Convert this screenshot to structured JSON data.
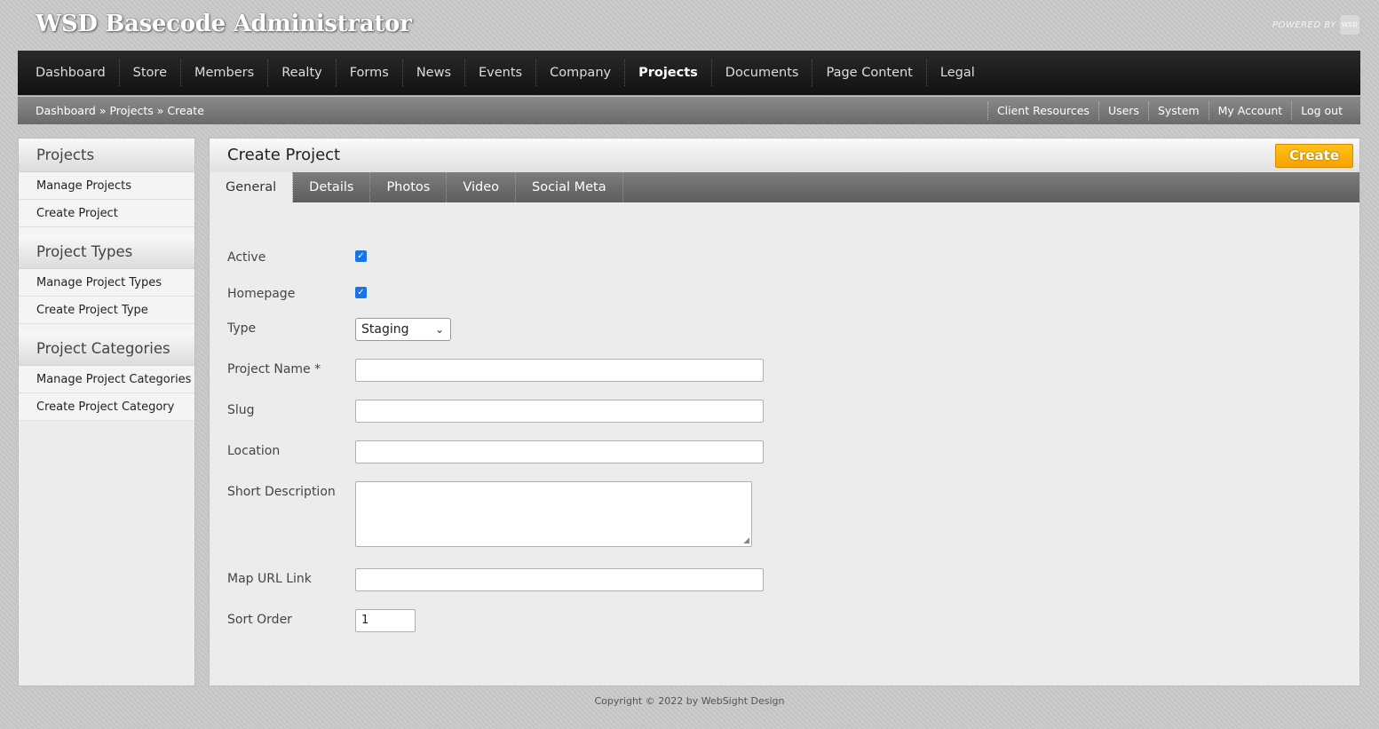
{
  "app": {
    "title": "WSD Basecode Administrator",
    "powered_by": "POWERED BY",
    "powered_logo": "WSD"
  },
  "topnav": {
    "items": [
      "Dashboard",
      "Store",
      "Members",
      "Realty",
      "Forms",
      "News",
      "Events",
      "Company",
      "Projects",
      "Documents",
      "Page Content",
      "Legal"
    ],
    "active": "Projects"
  },
  "breadcrumb": {
    "items": [
      "Dashboard",
      "Projects",
      "Create"
    ],
    "separator": "»"
  },
  "util_links": [
    "Client Resources",
    "Users",
    "System",
    "My Account",
    "Log out"
  ],
  "sidebar": {
    "sections": [
      {
        "title": "Projects",
        "items": [
          "Manage Projects",
          "Create Project"
        ]
      },
      {
        "title": "Project Types",
        "items": [
          "Manage Project Types",
          "Create Project Type"
        ]
      },
      {
        "title": "Project Categories",
        "items": [
          "Manage Project Categories",
          "Create Project Category"
        ]
      }
    ]
  },
  "main": {
    "title": "Create Project",
    "create_button": "Create",
    "tabs": [
      "General",
      "Details",
      "Photos",
      "Video",
      "Social Meta"
    ],
    "active_tab": "General"
  },
  "form": {
    "active_label": "Active",
    "active_checked": true,
    "homepage_label": "Homepage",
    "homepage_checked": true,
    "type_label": "Type",
    "type_value": "Staging",
    "project_name_label": "Project Name *",
    "project_name_value": "",
    "slug_label": "Slug",
    "slug_value": "",
    "location_label": "Location",
    "location_value": "",
    "short_description_label": "Short Description",
    "short_description_value": "",
    "map_url_label": "Map URL Link",
    "map_url_value": "",
    "sort_order_label": "Sort Order",
    "sort_order_value": "1"
  },
  "footer": {
    "text": "Copyright © 2022 by WebSight Design"
  },
  "colors": {
    "accent": "#f5a200",
    "checkbox": "#1a73e8",
    "nav_bg": "#1a1a1a"
  }
}
